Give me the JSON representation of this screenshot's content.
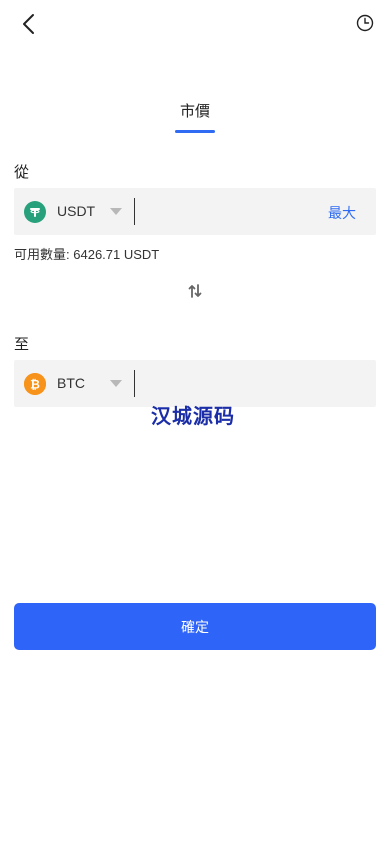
{
  "header": {
    "back_icon": "chevron-left-icon",
    "history_icon": "clock-icon"
  },
  "tabs": [
    {
      "label": "市價",
      "active": true
    }
  ],
  "from": {
    "label": "從",
    "coin": "USDT",
    "coin_icon": "tether-icon",
    "coin_color": "#26a17b",
    "max_label": "最大",
    "amount_value": "",
    "available_label": "可用數量:",
    "available_value": "6426.71 USDT"
  },
  "swap_icon": "swap-arrows-icon",
  "to": {
    "label": "至",
    "coin": "BTC",
    "coin_icon": "bitcoin-icon",
    "coin_color": "#f7931a",
    "amount_value": ""
  },
  "watermark": "汉城源码",
  "confirm_label": "確定",
  "colors": {
    "accent": "#2f6cf3",
    "button": "#2f64f8",
    "field_bg": "#f3f3f3"
  }
}
